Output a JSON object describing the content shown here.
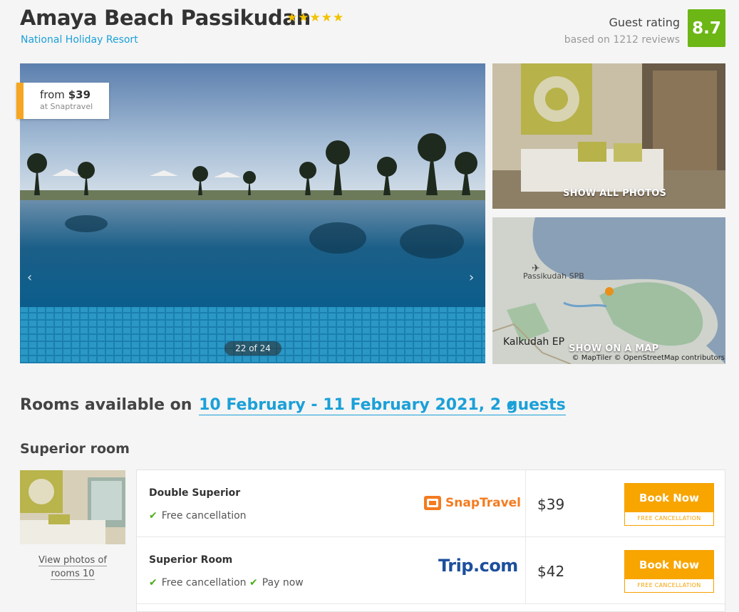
{
  "hotel": {
    "name": "Amaya Beach Passikudah",
    "stars": [
      "★",
      "★",
      "★",
      "★",
      "★"
    ],
    "subtitle": "National Holiday Resort"
  },
  "rating": {
    "label": "Guest rating",
    "reviews": "based on 1212 reviews",
    "score": "8.7",
    "color": "#6cb615"
  },
  "gallery": {
    "price_from": "from",
    "price_value": "$39",
    "price_source": "at Snaptravel",
    "counter": "22 of 24",
    "show_all_photos": "SHOW ALL PHOTOS",
    "show_on_map": "SHOW ON A MAP",
    "map_labels": {
      "airport": "Passikudah SPB",
      "town": "Kalkudah EP"
    },
    "map_credit": "© MapTiler © OpenStreetMap contributors"
  },
  "rooms": {
    "heading_prefix": "Rooms available on",
    "dates": "10 February - 11 February 2021, 2 guests",
    "room_type": "Superior room",
    "view_photos_line1": "View photos of",
    "view_photos_line2": "rooms 10",
    "offers": [
      {
        "name": "Double Superior",
        "features": [
          "Free cancellation"
        ],
        "provider": "SnapTravel",
        "price": "$39",
        "book_label": "Book Now",
        "cancel_label": "FREE CANCELLATION"
      },
      {
        "name": "Superior Room",
        "features": [
          "Free cancellation",
          "Pay now"
        ],
        "provider": "Trip.com",
        "price": "$42",
        "book_label": "Book Now",
        "cancel_label": "FREE CANCELLATION"
      }
    ]
  },
  "colors": {
    "accent_blue": "#1ba0d8",
    "book_orange": "#f8a500",
    "snaptravel_orange": "#f47b20",
    "trip_blue": "#1d4f9c"
  }
}
